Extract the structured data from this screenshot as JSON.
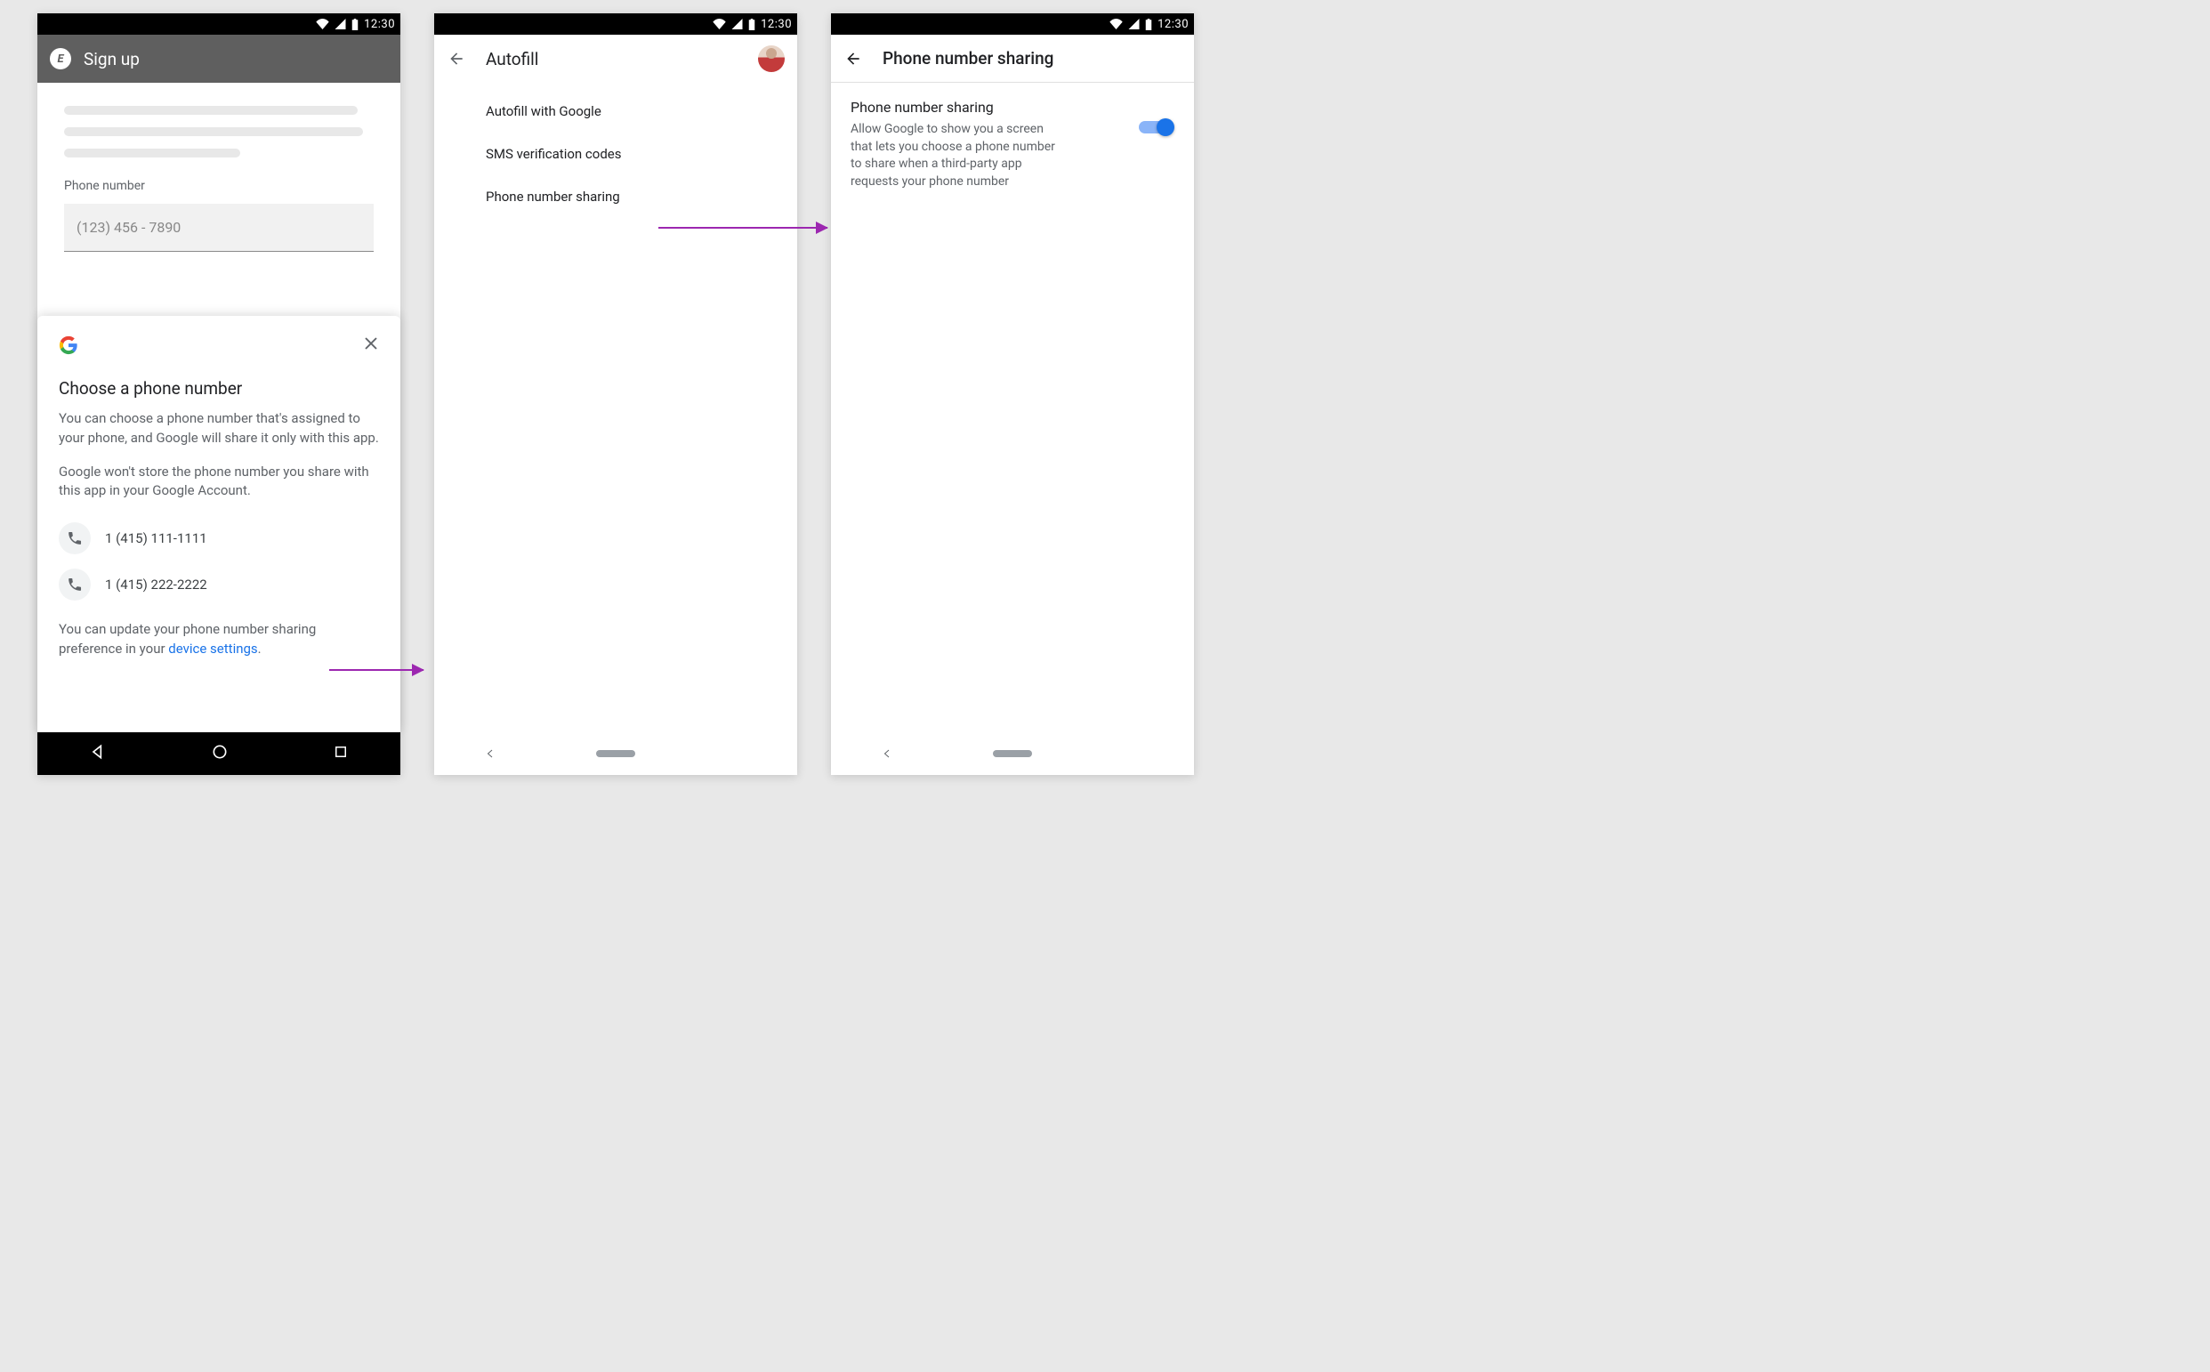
{
  "status": {
    "time": "12:30"
  },
  "screen1": {
    "app_title": "Sign up",
    "app_logo_letter": "E",
    "phone_label": "Phone number",
    "phone_placeholder": "(123) 456 - 7890",
    "sheet": {
      "title": "Choose a phone number",
      "p1": "You can choose a phone number that's assigned to your phone, and Google will share it only with this app.",
      "p2": "Google won't store the phone number you share with this app in your Google Account.",
      "numbers": [
        "1 (415) 111-1111",
        "1 (415) 222-2222"
      ],
      "footer_a": "You can update your phone number sharing preference in your ",
      "footer_link": "device settings",
      "footer_b": "."
    }
  },
  "screen2": {
    "title": "Autofill",
    "items": [
      "Autofill with Google",
      "SMS verification codes",
      "Phone number sharing"
    ]
  },
  "screen3": {
    "title": "Phone number sharing",
    "setting_title": "Phone number sharing",
    "setting_desc": "Allow Google to show you a screen that lets you choose a phone number to share when a third-party app requests your phone number"
  }
}
